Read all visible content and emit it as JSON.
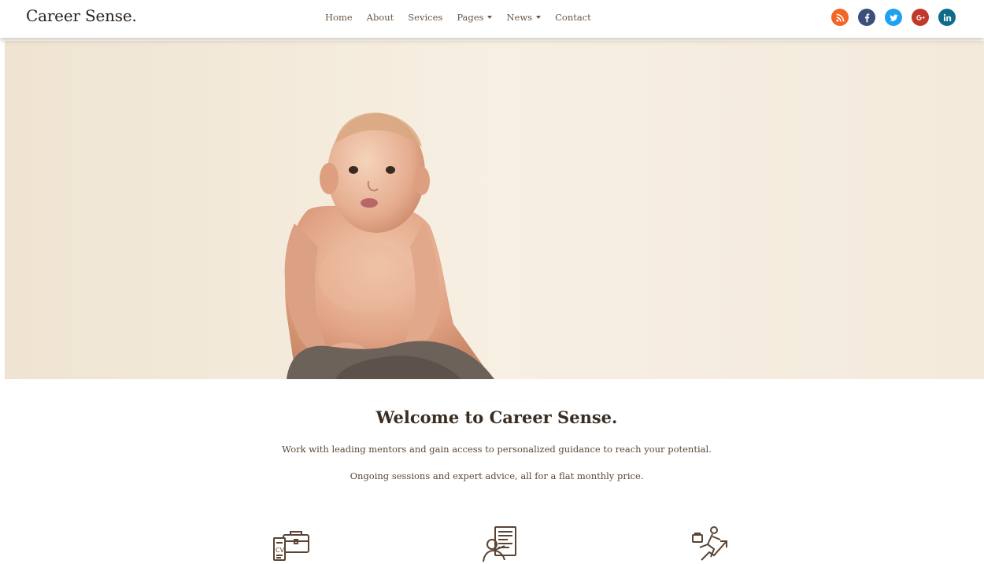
{
  "brand": {
    "name": "Career Sense."
  },
  "nav": {
    "items": [
      {
        "label": "Home",
        "dropdown": false
      },
      {
        "label": "About",
        "dropdown": false
      },
      {
        "label": "Sevices",
        "dropdown": false
      },
      {
        "label": "Pages",
        "dropdown": true
      },
      {
        "label": "News",
        "dropdown": true
      },
      {
        "label": "Contact",
        "dropdown": false
      }
    ]
  },
  "social": [
    {
      "name": "rss-icon",
      "color": "#f26522"
    },
    {
      "name": "facebook-icon",
      "color": "#3b4f7a"
    },
    {
      "name": "twitter-icon",
      "color": "#1da1f2"
    },
    {
      "name": "google-plus-icon",
      "color": "#c0392b"
    },
    {
      "name": "linkedin-icon",
      "color": "#0e6c8a"
    }
  ],
  "hero": {
    "image": "baby-photo"
  },
  "welcome": {
    "title": "Welcome to Career Sense.",
    "line1": "Work with leading mentors and gain access to personalized guidance to reach your potential.",
    "line2": "Ongoing sessions and expert advice, all for a flat monthly price."
  },
  "features": [
    {
      "icon": "cv-briefcase-icon"
    },
    {
      "icon": "mentor-document-icon"
    },
    {
      "icon": "career-growth-icon"
    }
  ],
  "colors": {
    "text": "#4a3f35",
    "heading": "#3a2d22",
    "icon": "#5a4434"
  }
}
